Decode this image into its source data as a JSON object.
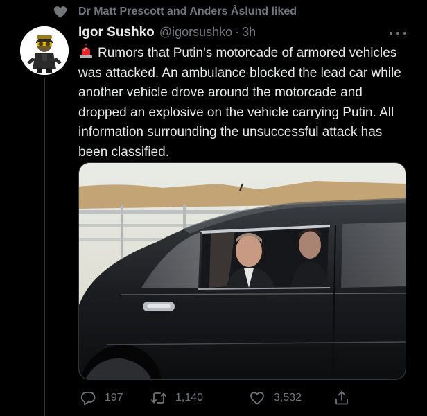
{
  "social_context": {
    "text": "Dr Matt Prescott and Anders Åslund liked"
  },
  "tweet": {
    "author_name": "Igor Sushko",
    "handle": "@igorsushko",
    "separator": "·",
    "time": "3h",
    "text": "Rumors that Putin's motorcade of armored vehicles was attacked. An ambulance blocked the lead car while another vehicle drove around the motorcade and dropped an explosive on the vehicle carrying Putin. All information surrounding the unsuccessful attack has been classified.",
    "leading_icon": "siren-emoji"
  },
  "actions": {
    "reply_count": "197",
    "retweet_count": "1,140",
    "like_count": "3,532"
  },
  "colors": {
    "background": "#000000",
    "text_primary": "#e7e9ea",
    "text_secondary": "#71767b"
  },
  "icons": [
    "heart-icon",
    "more-icon",
    "siren-icon",
    "reply-icon",
    "retweet-icon",
    "like-icon",
    "share-icon"
  ]
}
